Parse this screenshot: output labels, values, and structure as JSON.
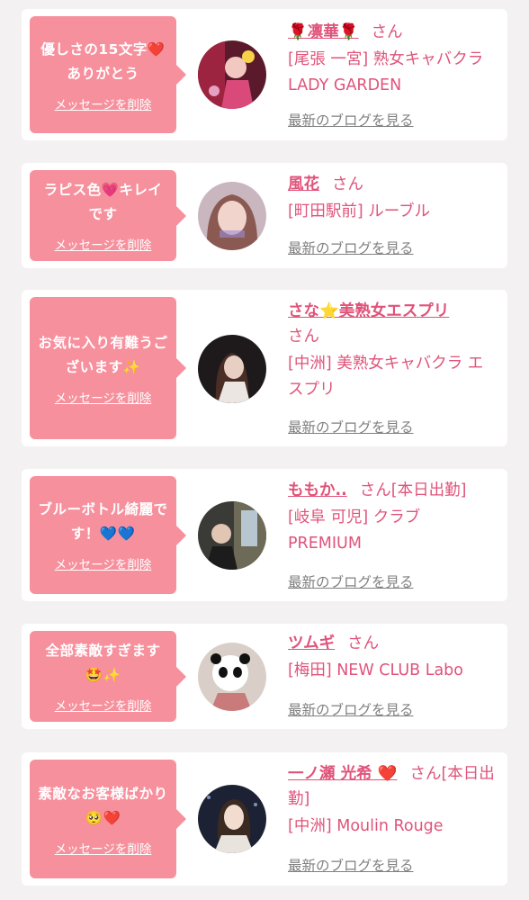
{
  "cards": [
    {
      "message": "優しさの15文字❤️ありがとう",
      "delete_label": "メッセージを削除",
      "name": "🌹凛華🌹",
      "san": "さん",
      "shop": "[尾張 一宮] 熟女キャバクラ LADY GARDEN",
      "blog_label": "最新のブログを見る"
    },
    {
      "message": "ラピス色💗キレイです",
      "delete_label": "メッセージを削除",
      "name": "風花",
      "san": "さん",
      "shop": "[町田駅前] ルーブル",
      "blog_label": "最新のブログを見る"
    },
    {
      "message": "お気に入り有難うございます✨",
      "delete_label": "メッセージを削除",
      "name": "さな⭐美熟女エスプリ",
      "san": "さん",
      "shop": "[中洲] 美熟女キャバクラ エスプリ",
      "blog_label": "最新のブログを見る"
    },
    {
      "message": "ブルーボトル綺麗です！💙💙",
      "delete_label": "メッセージを削除",
      "name": "ももか..",
      "san": "さん[本日出勤]",
      "shop": "[岐阜 可児] クラブ PREMIUM",
      "blog_label": "最新のブログを見る"
    },
    {
      "message": "全部素敵すぎます🤩✨",
      "delete_label": "メッセージを削除",
      "name": "ツムギ",
      "san": "さん",
      "shop": "[梅田] NEW CLUB Labo",
      "blog_label": "最新のブログを見る"
    },
    {
      "message": "素敵なお客様ばかり🥺❤️",
      "delete_label": "メッセージを削除",
      "name": "一ノ瀬 光希 ❤️",
      "san": "さん[本日出勤]",
      "shop": "[中洲] Moulin Rouge",
      "blog_label": "最新のブログを見る"
    }
  ],
  "colors": {
    "bubble": "#f7909d",
    "accent": "#e0537a",
    "link_gray": "#808080",
    "background": "#f3f1f2"
  }
}
